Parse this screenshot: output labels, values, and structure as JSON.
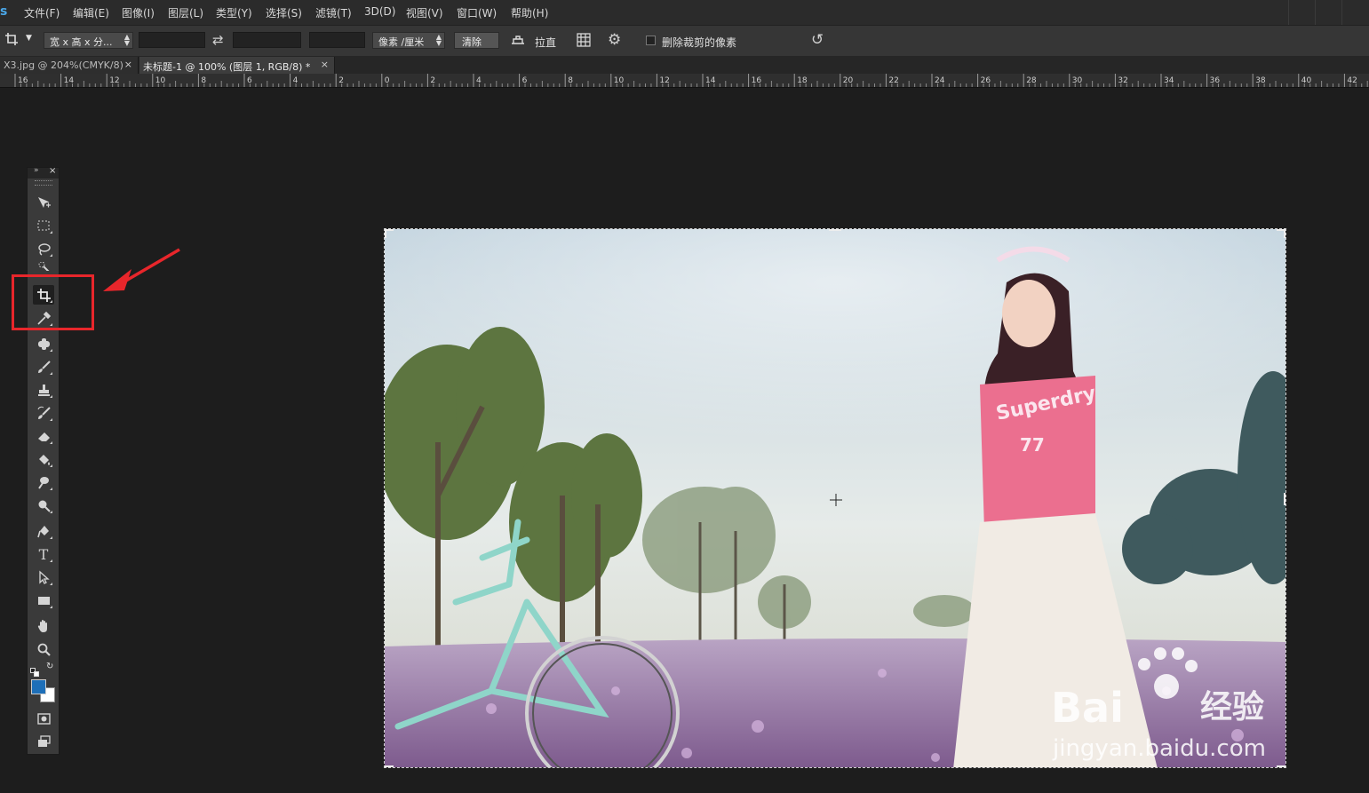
{
  "app": {
    "logo": "s"
  },
  "menu": [
    "文件(F)",
    "编辑(E)",
    "图像(I)",
    "图层(L)",
    "类型(Y)",
    "选择(S)",
    "滤镜(T)",
    "3D(D)",
    "视图(V)",
    "窗口(W)",
    "帮助(H)"
  ],
  "options": {
    "ratio_select": "宽 x 高 x 分...",
    "unit_select": "像素 /厘米",
    "clear_button": "清除",
    "straighten_label": "拉直",
    "delete_cropped_label": "删除裁剪的像素",
    "delete_cropped_checked": false
  },
  "tabs": [
    {
      "label": "X3.jpg @ 204%(CMYK/8)",
      "active": false
    },
    {
      "label": "未标题-1 @ 100% (图层 1, RGB/8) *",
      "active": true
    }
  ],
  "ruler": {
    "labels": [
      "16",
      "14",
      "12",
      "10",
      "8",
      "6",
      "4",
      "2",
      "0",
      "2",
      "4",
      "6",
      "8",
      "10",
      "12",
      "14",
      "16",
      "18",
      "20",
      "22",
      "24",
      "26",
      "28",
      "30",
      "32",
      "34",
      "36",
      "38",
      "40",
      "42"
    ]
  },
  "tools": [
    "move-tool",
    "marquee-tool",
    "lasso-tool",
    "quick-select-tool",
    "crop-tool",
    "eyedropper-tool",
    "healing-brush-tool",
    "brush-tool",
    "clone-stamp-tool",
    "history-brush-tool",
    "eraser-tool",
    "paint-bucket-tool",
    "blur-tool",
    "dodge-tool",
    "pen-tool",
    "type-tool",
    "path-select-tool",
    "rectangle-tool",
    "hand-tool",
    "zoom-tool"
  ],
  "selected_tool": "crop-tool",
  "colors": {
    "foreground": "#1e6fb8",
    "background": "#ffffff",
    "highlight": "#e8262b",
    "annotation_arrow": "#e8262b"
  },
  "canvas": {
    "image_description_icon": "photo-girl-bicycle-flower-field",
    "shirt_text": "Superdry",
    "shirt_number": "77"
  },
  "watermark": {
    "brand": "Bai",
    "brand_suffix": "经验",
    "url": "jingyan.baidu.com"
  }
}
